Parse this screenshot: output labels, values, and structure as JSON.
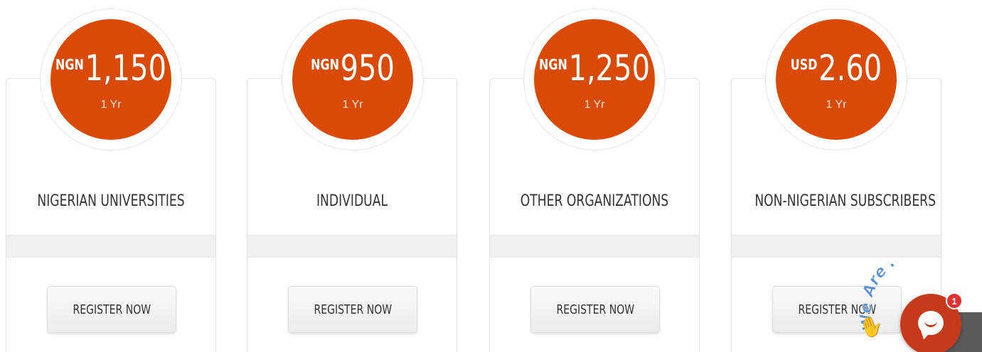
{
  "plans": [
    {
      "currency": "NGN",
      "amount": "1,150",
      "period": "1 Yr",
      "title": "NIGERIAN UNIVERSITIES",
      "button": "REGISTER NOW"
    },
    {
      "currency": "NGN",
      "amount": "950",
      "period": "1 Yr",
      "title": "INDIVIDUAL",
      "button": "REGISTER NOW"
    },
    {
      "currency": "NGN",
      "amount": "1,250",
      "period": "1 Yr",
      "title": "OTHER ORGANIZATIONS",
      "button": "REGISTER NOW"
    },
    {
      "currency": "USD",
      "amount": "2.60",
      "period": "1 Yr",
      "title": "NON-NIGERIAN SUBSCRIBERS",
      "button": "REGISTER NOW"
    }
  ],
  "chat": {
    "banner": "We Are Here!",
    "badge_count": "1",
    "icons": {
      "launcher": "chat-bubble-icon",
      "wave": "waving-hand-icon"
    }
  },
  "colors": {
    "price_circle": "#d84a05",
    "chat_bubble": "#c63a1c",
    "badge": "#e0322f"
  }
}
